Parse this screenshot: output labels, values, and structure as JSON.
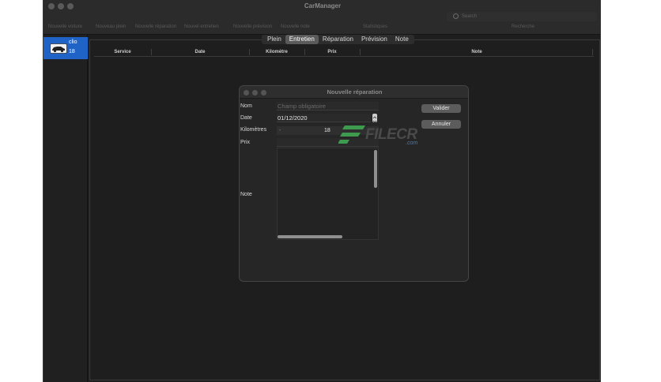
{
  "window": {
    "title": "CarManager",
    "search_placeholder": "Search",
    "search_caption": "Recherche"
  },
  "toolbar": {
    "items": [
      {
        "label": "Nouvelle voiture"
      },
      {
        "label": "Nouveau plein"
      },
      {
        "label": "Nouvelle réparation"
      },
      {
        "label": "Nouvel entretien"
      },
      {
        "label": "Nouvelle prévision"
      },
      {
        "label": "Nouvelle note"
      },
      {
        "label": "Statistiques"
      }
    ]
  },
  "sidebar": {
    "cars": [
      {
        "name": "clio",
        "km": "18"
      }
    ]
  },
  "tabs": [
    {
      "label": "Plein",
      "active": false
    },
    {
      "label": "Entretien",
      "active": true
    },
    {
      "label": "Réparation",
      "active": false
    },
    {
      "label": "Prévision",
      "active": false
    },
    {
      "label": "Note",
      "active": false
    }
  ],
  "table": {
    "columns": [
      "Service",
      "Date",
      "Kilomètre",
      "Prix",
      "Note"
    ]
  },
  "dialog": {
    "title": "Nouvelle réparation",
    "fields": {
      "nom_label": "Nom",
      "nom_placeholder": "Champ obligatoire",
      "date_label": "Date",
      "date_value": "01/12/2020",
      "km_label": "Kilomètres",
      "km_minus": "-",
      "km_value": "18",
      "prix_label": "Prix",
      "note_label": "Note"
    },
    "buttons": {
      "validate": "Valider",
      "cancel": "Annuler"
    }
  },
  "watermark": {
    "text": "FILECR",
    "suffix": ".com"
  },
  "colors": {
    "selection": "#1f63c7",
    "watermark_green": "#3e9a4f",
    "watermark_blue": "#3f7dbf"
  }
}
